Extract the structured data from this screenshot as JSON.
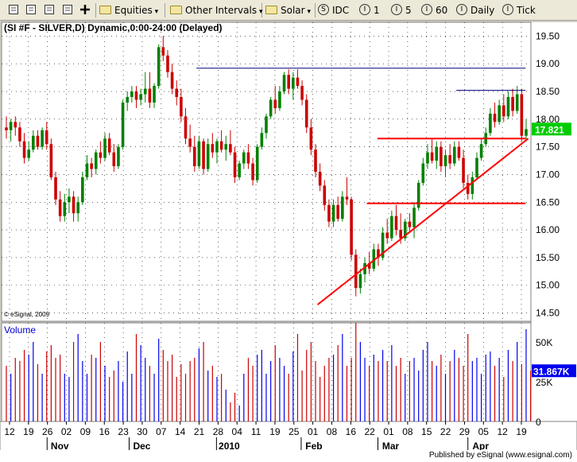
{
  "toolbar": {
    "items": [
      {
        "kind": "icon",
        "name": "grid-icon"
      },
      {
        "kind": "icon",
        "name": "copy-icon"
      },
      {
        "kind": "icon",
        "name": "link-icon"
      },
      {
        "kind": "icon",
        "name": "properties-icon"
      },
      {
        "kind": "icon",
        "name": "crosshair-icon"
      },
      {
        "kind": "folder",
        "label": "Equities"
      },
      {
        "kind": "folder",
        "label": "Other Intervals"
      },
      {
        "kind": "folder",
        "label": "Solar"
      },
      {
        "kind": "circle",
        "glyph": "S",
        "label": "IDC"
      },
      {
        "kind": "circle",
        "glyph": "I",
        "label": "1"
      },
      {
        "kind": "circle",
        "glyph": "I",
        "label": "5"
      },
      {
        "kind": "circle",
        "glyph": "I",
        "label": "60"
      },
      {
        "kind": "circle",
        "glyph": "I",
        "label": "Daily"
      },
      {
        "kind": "circle",
        "glyph": "I",
        "label": "Tick"
      }
    ]
  },
  "chart_data": [
    {
      "type": "candlestick",
      "title": "(SI #F - SILVER,D) Dynamic,0:00-24:00 (Delayed)",
      "copyright": "© eSignal, 2009",
      "ylim": [
        14.35,
        19.75
      ],
      "yticks": [
        "19.50",
        "19.00",
        "18.50",
        "18.00",
        "17.50",
        "17.00",
        "16.50",
        "16.00",
        "15.50",
        "15.00",
        "14.50"
      ],
      "last_price": "17.821",
      "colors": {
        "up": "#008000",
        "down": "#cc0000",
        "hline": "#000080",
        "trend": "#ff0000",
        "last_bg": "#00cc00"
      },
      "candles": [
        [
          17.85,
          18.05,
          17.65,
          17.8
        ],
        [
          17.8,
          18.0,
          17.6,
          17.95
        ],
        [
          17.95,
          18.05,
          17.7,
          17.85
        ],
        [
          17.85,
          17.95,
          17.5,
          17.6
        ],
        [
          17.6,
          17.75,
          17.2,
          17.3
        ],
        [
          17.3,
          17.6,
          17.25,
          17.45
        ],
        [
          17.45,
          17.8,
          17.4,
          17.7
        ],
        [
          17.7,
          17.8,
          17.45,
          17.5
        ],
        [
          17.5,
          17.85,
          17.45,
          17.8
        ],
        [
          17.8,
          17.95,
          17.45,
          17.55
        ],
        [
          17.55,
          17.65,
          16.9,
          16.95
        ],
        [
          16.95,
          17.05,
          16.45,
          16.55
        ],
        [
          16.55,
          16.7,
          16.15,
          16.25
        ],
        [
          16.25,
          16.65,
          16.15,
          16.5
        ],
        [
          16.5,
          16.75,
          16.3,
          16.6
        ],
        [
          16.6,
          16.7,
          16.15,
          16.3
        ],
        [
          16.3,
          16.6,
          16.15,
          16.5
        ],
        [
          16.5,
          17.05,
          16.45,
          16.95
        ],
        [
          16.95,
          17.35,
          16.9,
          17.2
        ],
        [
          17.2,
          17.3,
          16.95,
          17.1
        ],
        [
          17.1,
          17.45,
          17.0,
          17.4
        ],
        [
          17.4,
          17.6,
          17.2,
          17.3
        ],
        [
          17.3,
          17.75,
          17.25,
          17.65
        ],
        [
          17.65,
          17.75,
          17.35,
          17.4
        ],
        [
          17.4,
          17.55,
          17.05,
          17.15
        ],
        [
          17.15,
          17.55,
          17.1,
          17.5
        ],
        [
          17.5,
          18.35,
          17.45,
          18.3
        ],
        [
          18.3,
          18.5,
          18.15,
          18.4
        ],
        [
          18.4,
          18.6,
          18.3,
          18.5
        ],
        [
          18.5,
          18.6,
          18.2,
          18.35
        ],
        [
          18.35,
          18.55,
          18.25,
          18.45
        ],
        [
          18.45,
          18.85,
          18.3,
          18.55
        ],
        [
          18.55,
          18.85,
          18.2,
          18.3
        ],
        [
          18.3,
          18.65,
          18.2,
          18.6
        ],
        [
          18.6,
          19.35,
          18.55,
          19.3
        ],
        [
          19.3,
          19.5,
          19.05,
          19.15
        ],
        [
          19.15,
          19.25,
          18.75,
          18.85
        ],
        [
          18.85,
          19.0,
          18.45,
          18.55
        ],
        [
          18.55,
          18.7,
          18.25,
          18.4
        ],
        [
          18.4,
          18.55,
          17.95,
          18.05
        ],
        [
          18.05,
          18.2,
          17.55,
          17.65
        ],
        [
          17.65,
          17.9,
          17.4,
          17.5
        ],
        [
          17.5,
          17.7,
          17.05,
          17.15
        ],
        [
          17.15,
          17.7,
          17.1,
          17.6
        ],
        [
          17.6,
          17.65,
          17.0,
          17.1
        ],
        [
          17.1,
          17.65,
          17.05,
          17.55
        ],
        [
          17.55,
          17.75,
          17.3,
          17.4
        ],
        [
          17.4,
          17.65,
          17.2,
          17.6
        ],
        [
          17.6,
          17.8,
          17.4,
          17.45
        ],
        [
          17.45,
          17.7,
          17.25,
          17.55
        ],
        [
          17.55,
          17.8,
          17.35,
          17.4
        ],
        [
          17.4,
          17.5,
          16.85,
          16.95
        ],
        [
          16.95,
          17.25,
          16.9,
          17.2
        ],
        [
          17.2,
          17.45,
          17.1,
          17.4
        ],
        [
          17.4,
          17.55,
          17.1,
          17.2
        ],
        [
          17.2,
          17.3,
          16.8,
          16.9
        ],
        [
          16.9,
          17.55,
          16.85,
          17.5
        ],
        [
          17.5,
          17.85,
          17.45,
          17.75
        ],
        [
          17.75,
          18.1,
          17.65,
          18.05
        ],
        [
          18.05,
          18.4,
          18.0,
          18.35
        ],
        [
          18.35,
          18.6,
          18.1,
          18.2
        ],
        [
          18.2,
          18.6,
          18.15,
          18.5
        ],
        [
          18.5,
          18.85,
          18.45,
          18.8
        ],
        [
          18.8,
          18.9,
          18.45,
          18.55
        ],
        [
          18.55,
          18.85,
          18.35,
          18.75
        ],
        [
          18.75,
          18.9,
          18.55,
          18.6
        ],
        [
          18.6,
          18.7,
          18.25,
          18.35
        ],
        [
          18.35,
          18.45,
          17.75,
          17.85
        ],
        [
          17.85,
          18.0,
          17.35,
          17.45
        ],
        [
          17.45,
          17.55,
          16.95,
          17.05
        ],
        [
          17.05,
          17.2,
          16.7,
          16.8
        ],
        [
          16.8,
          16.9,
          16.35,
          16.45
        ],
        [
          16.45,
          16.55,
          16.05,
          16.15
        ],
        [
          16.15,
          16.55,
          16.05,
          16.45
        ],
        [
          16.45,
          16.6,
          16.15,
          16.2
        ],
        [
          16.2,
          16.7,
          16.15,
          16.6
        ],
        [
          16.6,
          16.95,
          16.45,
          16.55
        ],
        [
          16.55,
          16.6,
          15.45,
          15.55
        ],
        [
          15.55,
          15.65,
          14.8,
          14.95
        ],
        [
          14.95,
          15.3,
          14.85,
          15.2
        ],
        [
          15.2,
          15.5,
          15.05,
          15.4
        ],
        [
          15.4,
          15.6,
          15.2,
          15.3
        ],
        [
          15.3,
          15.75,
          15.25,
          15.65
        ],
        [
          15.65,
          15.75,
          15.35,
          15.5
        ],
        [
          15.5,
          16.05,
          15.45,
          15.95
        ],
        [
          15.95,
          16.2,
          15.75,
          15.85
        ],
        [
          15.85,
          16.35,
          15.8,
          16.25
        ],
        [
          16.25,
          16.45,
          15.9,
          16.0
        ],
        [
          16.0,
          16.3,
          15.75,
          15.85
        ],
        [
          15.85,
          16.2,
          15.8,
          16.15
        ],
        [
          16.15,
          16.3,
          15.95,
          16.05
        ],
        [
          16.05,
          16.5,
          15.85,
          16.4
        ],
        [
          16.4,
          16.9,
          16.35,
          16.85
        ],
        [
          16.85,
          17.3,
          16.8,
          17.2
        ],
        [
          17.2,
          17.55,
          17.1,
          17.4
        ],
        [
          17.4,
          17.65,
          17.2,
          17.25
        ],
        [
          17.25,
          17.6,
          17.1,
          17.5
        ],
        [
          17.5,
          17.6,
          17.05,
          17.15
        ],
        [
          17.15,
          17.45,
          16.95,
          17.35
        ],
        [
          17.35,
          17.55,
          17.1,
          17.2
        ],
        [
          17.2,
          17.6,
          17.15,
          17.5
        ],
        [
          17.5,
          17.6,
          17.25,
          17.3
        ],
        [
          17.3,
          17.45,
          16.75,
          16.85
        ],
        [
          16.85,
          17.0,
          16.55,
          16.65
        ],
        [
          16.65,
          17.05,
          16.55,
          16.95
        ],
        [
          16.95,
          17.4,
          16.9,
          17.3
        ],
        [
          17.3,
          17.65,
          17.25,
          17.55
        ],
        [
          17.55,
          17.85,
          17.5,
          17.75
        ],
        [
          17.75,
          18.2,
          17.7,
          18.1
        ],
        [
          18.1,
          18.3,
          17.85,
          17.95
        ],
        [
          17.95,
          18.35,
          17.9,
          18.25
        ],
        [
          18.25,
          18.45,
          17.95,
          18.05
        ],
        [
          18.05,
          18.5,
          18.0,
          18.4
        ],
        [
          18.4,
          18.55,
          18.05,
          18.15
        ],
        [
          18.15,
          18.6,
          18.1,
          18.45
        ],
        [
          18.45,
          18.55,
          17.6,
          17.7
        ],
        [
          17.7,
          18.0,
          17.6,
          17.82
        ]
      ],
      "hlines": [
        {
          "y": 18.92,
          "x0": 0.368,
          "x1": 0.99,
          "color": "#000080"
        },
        {
          "y": 18.52,
          "x0": 0.859,
          "x1": 0.99,
          "color": "#000080"
        },
        {
          "y": 17.65,
          "x0": 0.71,
          "x1": 0.99,
          "color": "#ff0000"
        },
        {
          "y": 16.48,
          "x0": 0.69,
          "x1": 0.99,
          "color": "#ff0000"
        }
      ],
      "trendline": {
        "from": [
          0.597,
          14.65
        ],
        "to": [
          0.995,
          17.65
        ]
      }
    },
    {
      "type": "bar",
      "title": "Volume",
      "ylim": [
        0,
        60
      ],
      "yticks": [
        "50K",
        "25K",
        "0"
      ],
      "last_value": "31.867K",
      "volumes": [
        35,
        30,
        40,
        38,
        45,
        42,
        50,
        36,
        30,
        44,
        48,
        40,
        42,
        30,
        28,
        50,
        55,
        38,
        30,
        42,
        40,
        50,
        35,
        28,
        32,
        38,
        25,
        44,
        30,
        55,
        48,
        40,
        35,
        30,
        52,
        45,
        38,
        42,
        28,
        36,
        30,
        38,
        40,
        46,
        50,
        32,
        35,
        28,
        30,
        20,
        12,
        18,
        10,
        30,
        40,
        35,
        42,
        45,
        30,
        38,
        48,
        40,
        35,
        30,
        44,
        55,
        32,
        45,
        50,
        38,
        28,
        35,
        40,
        42,
        48,
        55,
        35,
        40,
        62,
        50,
        40,
        35,
        42,
        38,
        45,
        38,
        48,
        35,
        40,
        30,
        38,
        40,
        32,
        45,
        50,
        38,
        35,
        42,
        30,
        38,
        45,
        40,
        35,
        55,
        38,
        40,
        30,
        42,
        44,
        35,
        40,
        28,
        45,
        38,
        50,
        36,
        58,
        31.9
      ],
      "colors": {
        "up": "#0000ee",
        "down": "#cc0000"
      }
    }
  ],
  "x_axis": {
    "day_ticks": [
      "12",
      "19",
      "26",
      "02",
      "09",
      "16",
      "23",
      "30",
      "07",
      "14",
      "21",
      "28",
      "04",
      "11",
      "19",
      "25",
      "01",
      "08",
      "16",
      "22",
      "01",
      "08",
      "15",
      "22",
      "29",
      "05",
      "12",
      "19"
    ],
    "month_labels": [
      "Nov",
      "Dec",
      "2010",
      "Feb",
      "Mar",
      "Apr"
    ]
  },
  "footer": "Published by eSignal (www.esignal.com)"
}
